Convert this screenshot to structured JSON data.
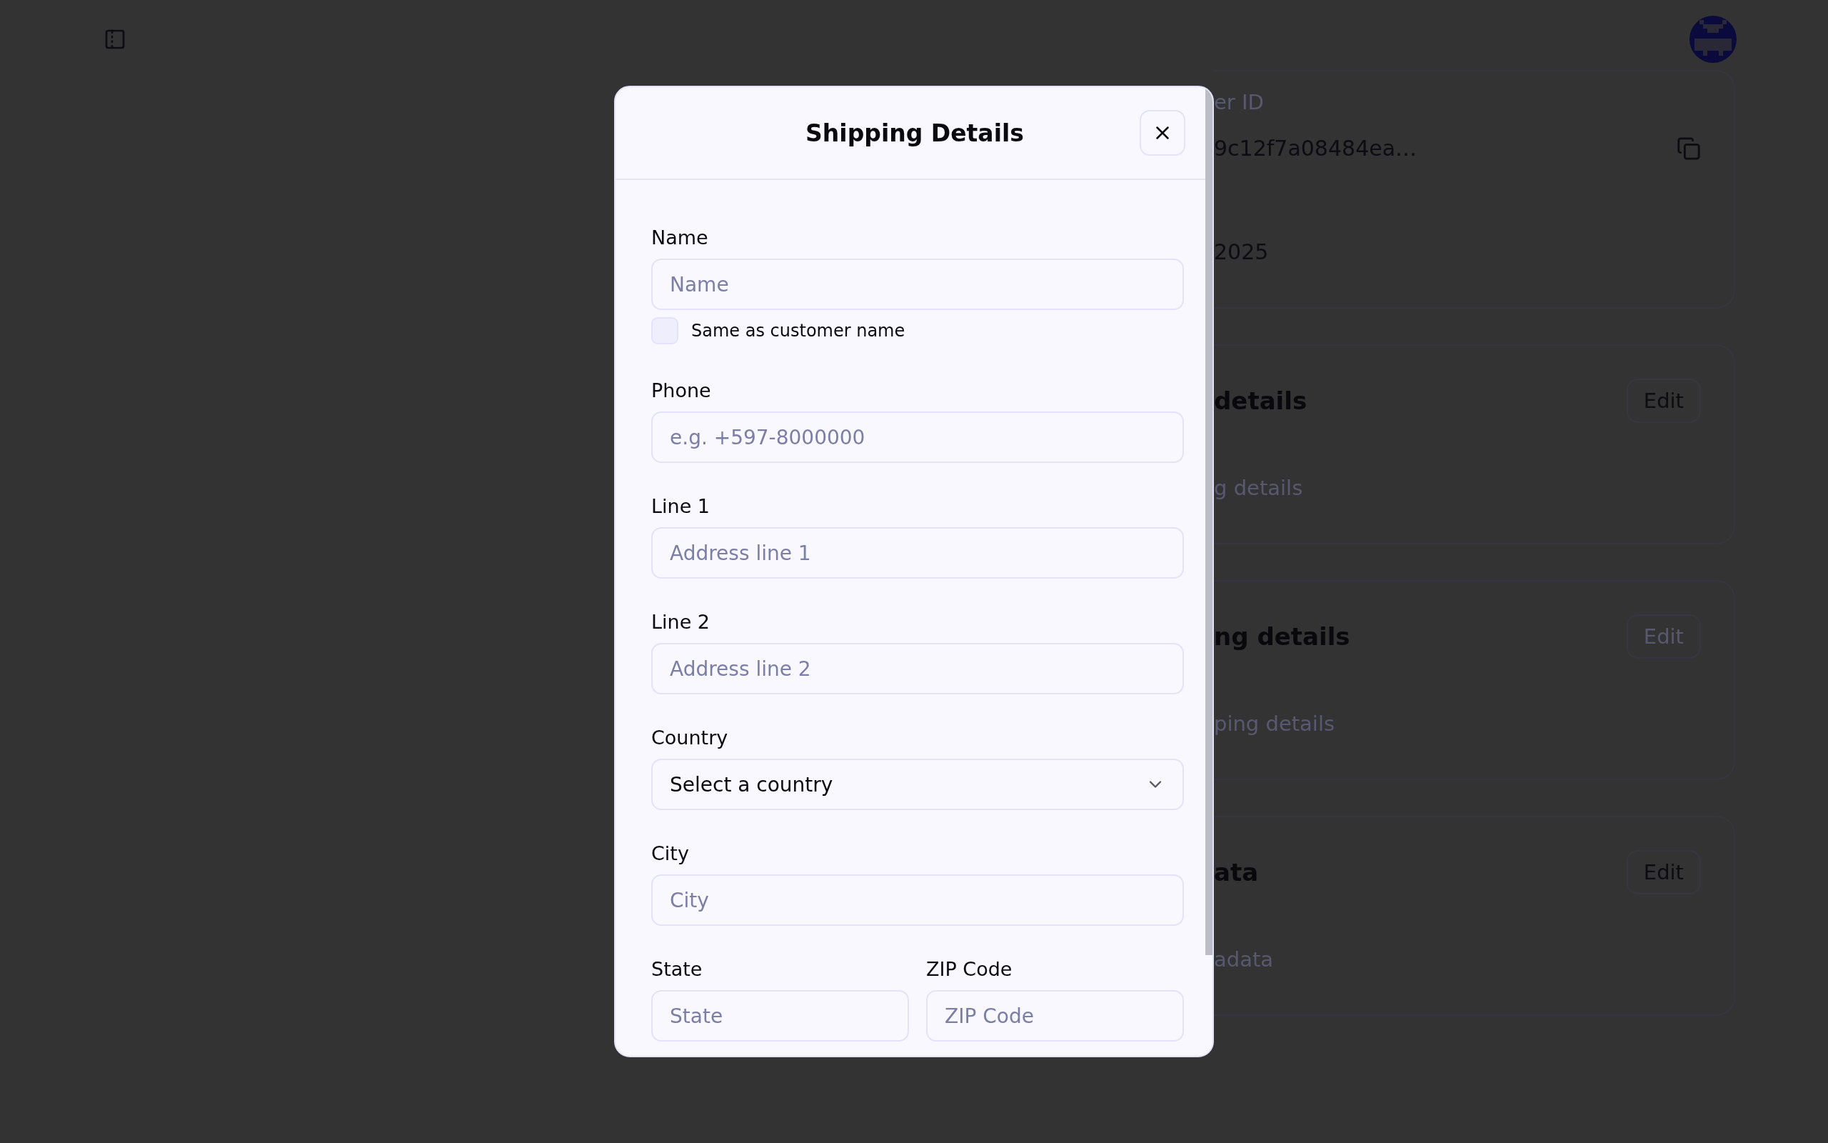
{
  "background": {
    "cards": [
      {
        "kind": "info",
        "label": "er ID",
        "value": "9c12f7a08484ea…",
        "date": "2025"
      },
      {
        "kind": "section",
        "title": "details",
        "subtitle": "g details",
        "button": {
          "label": "Edit",
          "disabled": false
        }
      },
      {
        "kind": "section",
        "title": "ng details",
        "subtitle": "ping details",
        "button": {
          "label": "Edit",
          "disabled": true
        }
      },
      {
        "kind": "section",
        "title": "ata",
        "subtitle": "adata",
        "button": {
          "label": "Edit",
          "disabled": false
        }
      }
    ]
  },
  "dialog": {
    "title": "Shipping Details",
    "fields": [
      {
        "kind": "text",
        "label": "Name",
        "placeholder": "Name"
      },
      {
        "kind": "checkbox",
        "label": "Same as customer name",
        "checked": false
      },
      {
        "kind": "text",
        "label": "Phone",
        "placeholder": "e.g. +597-8000000"
      },
      {
        "kind": "text",
        "label": "Line 1",
        "placeholder": "Address line 1"
      },
      {
        "kind": "text",
        "label": "Line 2",
        "placeholder": "Address line 2"
      },
      {
        "kind": "select",
        "label": "Country",
        "value": "Select a country"
      },
      {
        "kind": "text",
        "label": "City",
        "placeholder": "City"
      },
      {
        "kind": "pair",
        "fields": [
          {
            "label": "State",
            "placeholder": "State"
          },
          {
            "label": "ZIP Code",
            "placeholder": "ZIP Code"
          }
        ]
      }
    ]
  }
}
